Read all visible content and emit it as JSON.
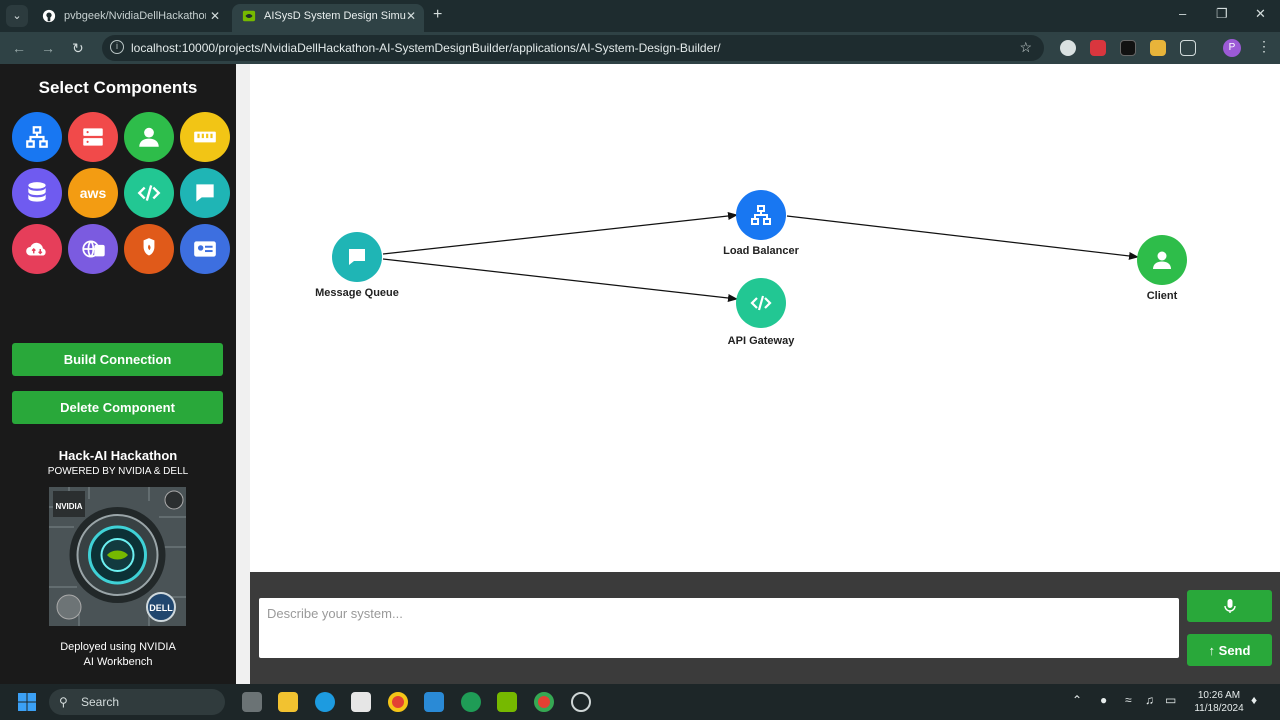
{
  "browser": {
    "tabs": [
      {
        "title": "pvbgeek/NvidiaDellHackathon-",
        "active": false
      },
      {
        "title": "AISysD System Design Simulato",
        "active": true
      }
    ],
    "url": "localhost:10000/projects/NvidiaDellHackathon-AI-SystemDesignBuilder/applications/AI-System-Design-Builder/",
    "profile_initial": "P"
  },
  "sidebar": {
    "title": "Select Components",
    "components": [
      {
        "name": "load-balancer",
        "color": "#1877f2"
      },
      {
        "name": "server",
        "color": "#f14a4a"
      },
      {
        "name": "client",
        "color": "#2ebd4a"
      },
      {
        "name": "cache",
        "color": "#f2c515"
      },
      {
        "name": "database",
        "color": "#6f5bf0"
      },
      {
        "name": "aws",
        "color": "#f39c12",
        "text": "aws"
      },
      {
        "name": "api-gateway",
        "color": "#22c793"
      },
      {
        "name": "message-queue",
        "color": "#1fb5b5"
      },
      {
        "name": "cdn",
        "color": "#e63e5a"
      },
      {
        "name": "dns",
        "color": "#7b5be0"
      },
      {
        "name": "firewall",
        "color": "#e05a1a"
      },
      {
        "name": "auth-service",
        "color": "#3d6fe0"
      }
    ],
    "build_connection_label": "Build Connection",
    "delete_component_label": "Delete Component",
    "hackathon_title": "Hack-AI Hackathon",
    "hackathon_subtitle": "POWERED BY NVIDIA & DELL",
    "poster_logo_text": "NVIDIA",
    "poster_dell_text": "DELL",
    "deploy_line1": "Deployed using NVIDIA",
    "deploy_line2": "AI Workbench"
  },
  "diagram": {
    "nodes": [
      {
        "id": "mq",
        "label": "Message Queue",
        "color": "#1fb5b5",
        "icon": "chat-icon"
      },
      {
        "id": "lb",
        "label": "Load Balancer",
        "color": "#1877f2",
        "icon": "network-icon"
      },
      {
        "id": "api",
        "label": "API Gateway",
        "color": "#22c793",
        "icon": "code-icon"
      },
      {
        "id": "client",
        "label": "Client",
        "color": "#2ebd4a",
        "icon": "user-icon"
      }
    ],
    "edges": [
      {
        "from": "Message Queue",
        "to": "Load Balancer"
      },
      {
        "from": "Message Queue",
        "to": "API Gateway"
      },
      {
        "from": "Load Balancer",
        "to": "Client"
      }
    ]
  },
  "chat": {
    "placeholder": "Describe your system...",
    "send_label": "Send"
  },
  "taskbar": {
    "search_label": "Search",
    "time": "10:26 AM",
    "date": "11/18/2024"
  }
}
